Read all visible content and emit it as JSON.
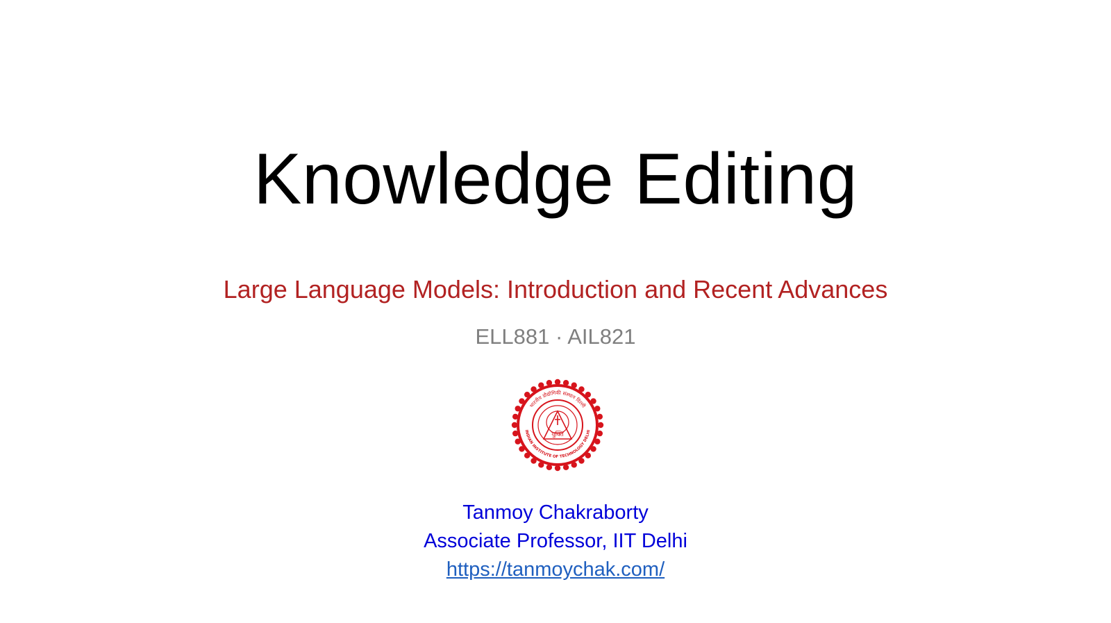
{
  "slide": {
    "title": "Knowledge Editing",
    "subtitle": "Large Language Models: Introduction and Recent Advances",
    "course_code": "ELL881 · AIL821",
    "author": {
      "name": "Tanmoy Chakraborty",
      "position": "Associate Professor, IIT Delhi",
      "website": "https://tanmoychak.com/"
    },
    "logo": {
      "icon": "iit-delhi-seal-icon",
      "ring_text_top": "भारतीय प्रौद्योगिकी संस्थान दिल्ली",
      "ring_text_bottom": "INDIAN INSTITUTE OF TECHNOLOGY DELHI",
      "motto": "युक्ति"
    }
  },
  "colors": {
    "background": "#ffffff",
    "title": "#000000",
    "subtitle": "#b22222",
    "course_code": "#7f7f7f",
    "author": "#0000d9",
    "link": "#1f5fbf",
    "logo": "#d7141c"
  }
}
